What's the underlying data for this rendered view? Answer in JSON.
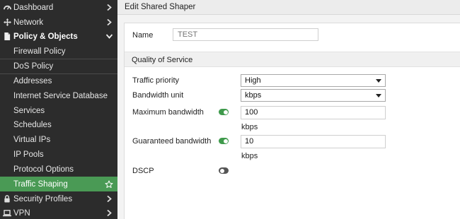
{
  "sidebar": {
    "items": [
      {
        "label": "Dashboard",
        "icon": "dashboard-icon",
        "chevron": "right"
      },
      {
        "label": "Network",
        "icon": "network-icon",
        "chevron": "right"
      },
      {
        "label": "Policy & Objects",
        "icon": "document-icon",
        "chevron": "down"
      },
      {
        "label": "Firewall Policy"
      },
      {
        "label": "DoS Policy"
      },
      {
        "label": "Addresses"
      },
      {
        "label": "Internet Service Database"
      },
      {
        "label": "Services"
      },
      {
        "label": "Schedules"
      },
      {
        "label": "Virtual IPs"
      },
      {
        "label": "IP Pools"
      },
      {
        "label": "Protocol Options"
      },
      {
        "label": "Traffic Shaping",
        "active": true,
        "star": "star-outline-icon"
      },
      {
        "label": "Security Profiles",
        "icon": "lock-icon",
        "chevron": "right"
      },
      {
        "label": "VPN",
        "icon": "laptop-icon",
        "chevron": "right"
      }
    ]
  },
  "header": {
    "title": "Edit Shared Shaper"
  },
  "form": {
    "name_label": "Name",
    "name_placeholder": "TEST",
    "section_title": "Quality of Service",
    "traffic_priority_label": "Traffic priority",
    "traffic_priority_value": "High",
    "bandwidth_unit_label": "Bandwidth unit",
    "bandwidth_unit_value": "kbps",
    "max_bandwidth_label": "Maximum bandwidth",
    "max_bandwidth_value": "100",
    "max_bandwidth_unit": "kbps",
    "guaranteed_bandwidth_label": "Guaranteed bandwidth",
    "guaranteed_bandwidth_value": "10",
    "guaranteed_bandwidth_unit": "kbps",
    "dscp_label": "DSCP"
  },
  "colors": {
    "accent_green": "#4a9a55",
    "sidebar_bg": "#2c2c2c"
  }
}
